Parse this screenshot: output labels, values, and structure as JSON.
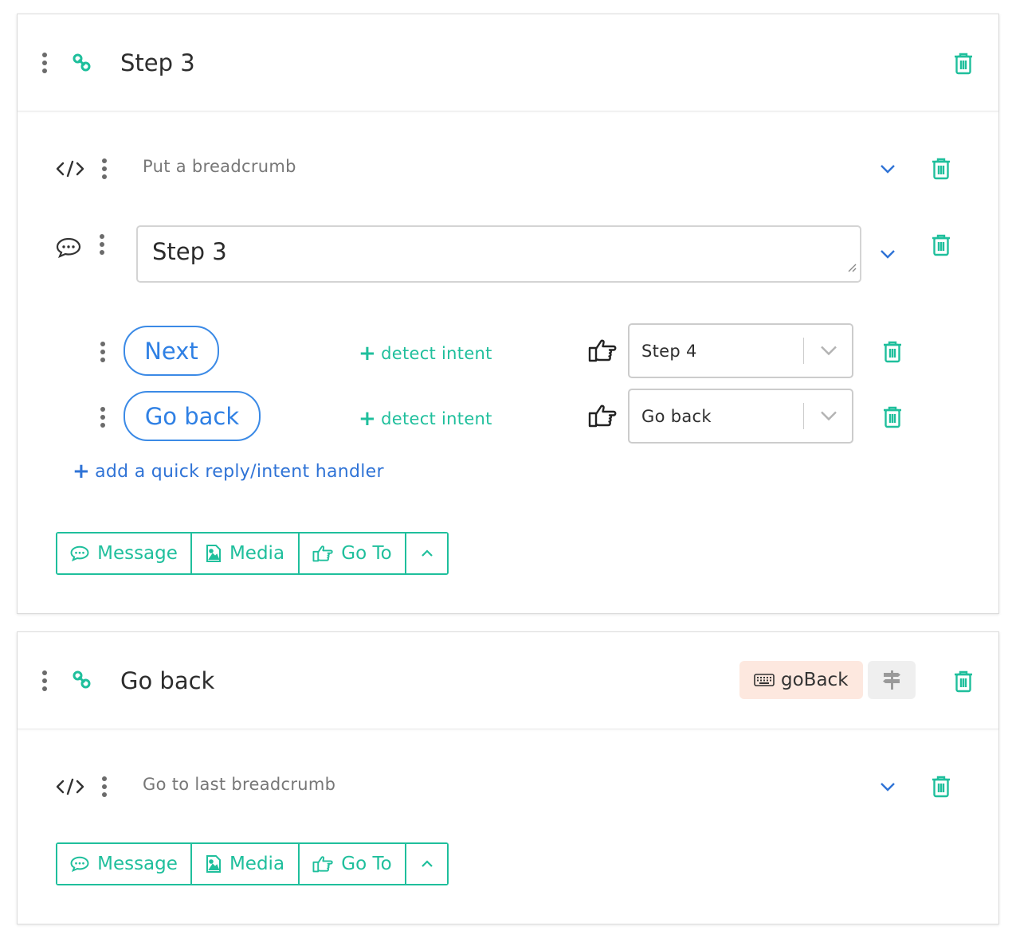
{
  "colors": {
    "accent": "#1fbf9c",
    "link_blue": "#2f80e4",
    "badge_bg": "#fde8df"
  },
  "cards": [
    {
      "title": "Step 3",
      "code_step": {
        "text": "Put a breadcrumb"
      },
      "message_step": {
        "value": "Step 3"
      },
      "quick_replies": [
        {
          "label": "Next",
          "detect": "detect intent",
          "target": "Step 4"
        },
        {
          "label": "Go back",
          "detect": "detect intent",
          "target": "Go back"
        }
      ],
      "add_handler": "add a quick reply/intent handler",
      "toolbar": {
        "message": "Message",
        "media": "Media",
        "goto": "Go To"
      }
    },
    {
      "title": "Go back",
      "badge": "goBack",
      "code_step": {
        "text": "Go to last breadcrumb"
      },
      "toolbar": {
        "message": "Message",
        "media": "Media",
        "goto": "Go To"
      }
    }
  ],
  "icons": [
    "drag-handle-icon",
    "link-icon",
    "trash-icon",
    "code-icon",
    "chat-bubble-icon",
    "pointing-hand-icon",
    "chevron-down-icon",
    "chevron-up-icon",
    "plus-icon",
    "image-icon",
    "keyboard-icon",
    "signpost-icon",
    "resize-grip-icon"
  ]
}
